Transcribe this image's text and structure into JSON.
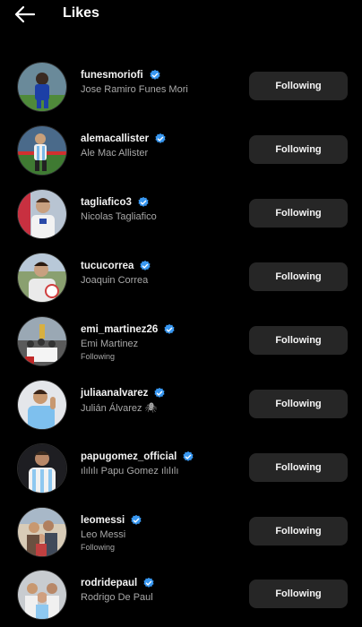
{
  "header": {
    "title": "Likes",
    "back_icon": "arrow-left-icon"
  },
  "accent": "#3897f0",
  "button_bg": "#262626",
  "users": [
    {
      "username": "funesmoriofi",
      "full_name": "Jose Ramiro Funes Mori",
      "verified": true,
      "subtitle": "",
      "button": "Following"
    },
    {
      "username": "alemacallister",
      "full_name": "Ale Mac Allister",
      "verified": true,
      "subtitle": "",
      "button": "Following"
    },
    {
      "username": "tagliafico3",
      "full_name": "Nicolas Tagliafico",
      "verified": true,
      "subtitle": "",
      "button": "Following"
    },
    {
      "username": "tucucorrea",
      "full_name": "Joaquin Correa",
      "verified": true,
      "subtitle": "",
      "button": "Following"
    },
    {
      "username": "emi_martinez26",
      "full_name": "Emi Martinez",
      "verified": true,
      "subtitle": "Following",
      "button": "Following"
    },
    {
      "username": "juliaanalvarez",
      "full_name": "Julián Álvarez 🕷",
      "verified": true,
      "subtitle": "",
      "button": "Following"
    },
    {
      "username": "papugomez_official",
      "full_name": "ılılılı Papu Gomez ılılılı",
      "verified": true,
      "subtitle": "",
      "button": "Following"
    },
    {
      "username": "leomessi",
      "full_name": "Leo Messi",
      "verified": true,
      "subtitle": "Following",
      "button": "Following"
    },
    {
      "username": "rodridepaul",
      "full_name": "Rodrigo De Paul",
      "verified": true,
      "subtitle": "",
      "button": "Following"
    }
  ]
}
